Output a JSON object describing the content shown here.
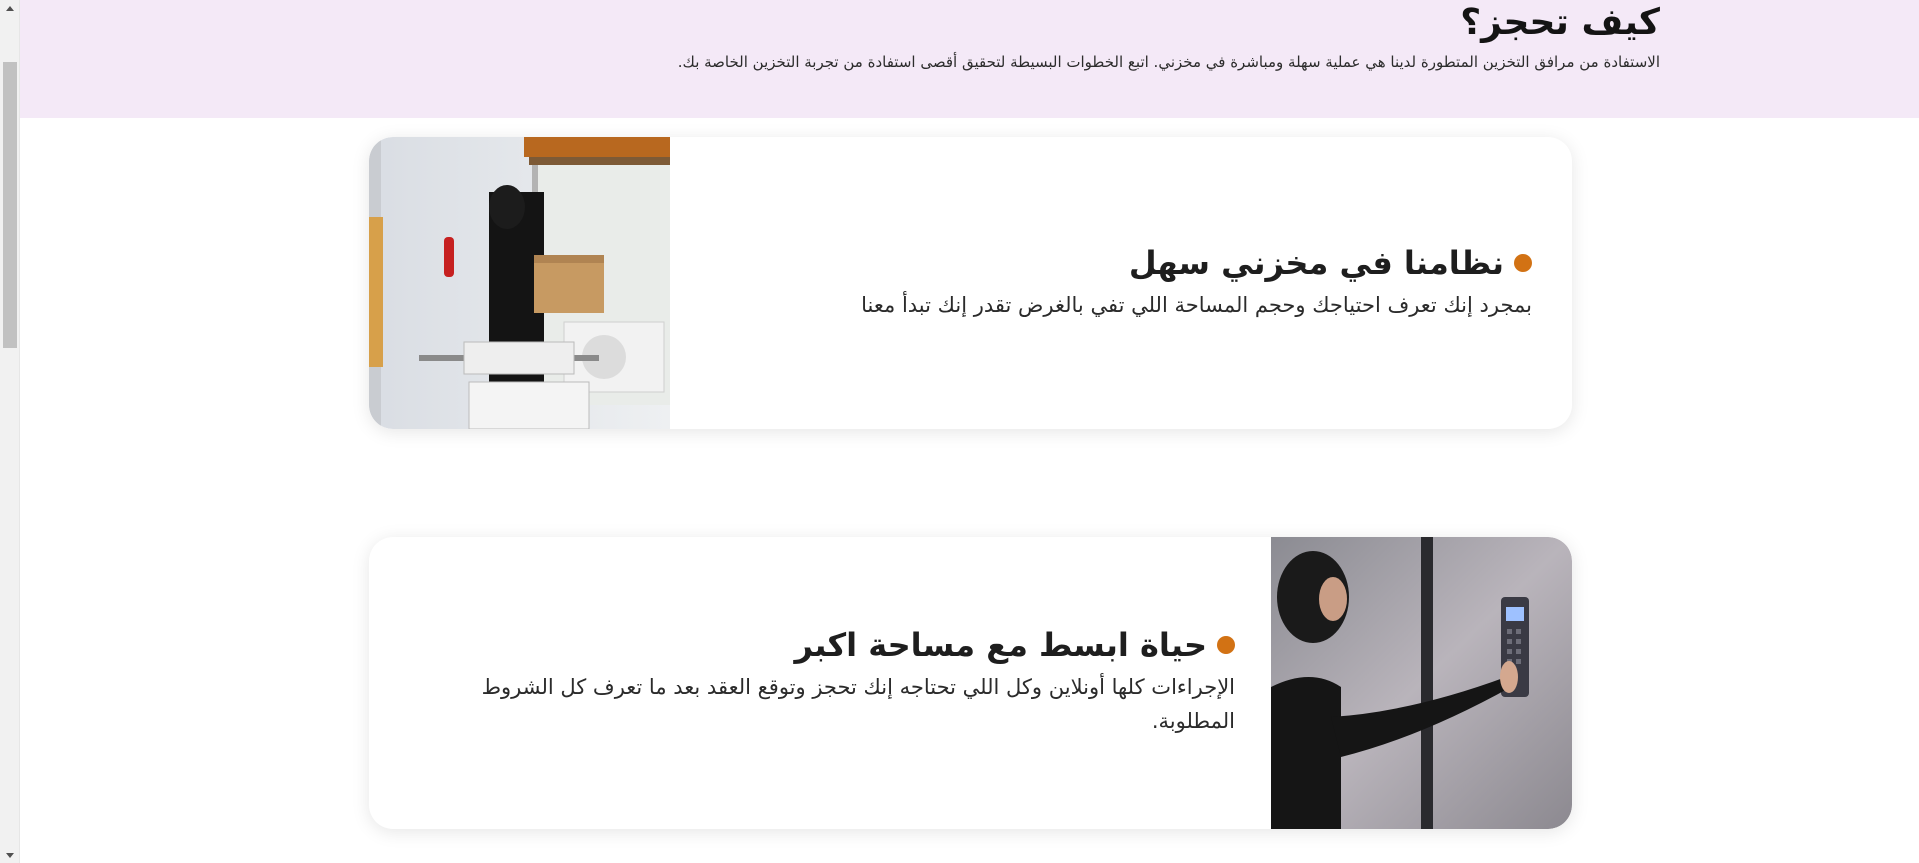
{
  "header": {
    "title": "كيف تحجز؟",
    "subtitle": "الاستفادة من مرافق التخزين المتطورة لدينا هي عملية سهلة ومباشرة في مخزني. اتبع الخطوات البسيطة لتحقيق أقصى استفادة من تجربة التخزين الخاصة بك."
  },
  "cards": [
    {
      "title": "نظامنا في مخزني سهل",
      "description": "بمجرد إنك تعرف احتياجك وحجم المساحة اللي تفي بالغرض تقدر إنك تبدأ معنا",
      "image": "woman-carrying-box-storage-photo"
    },
    {
      "title": "حياة ابسط مع مساحة اكبر",
      "description": "الإجراءات كلها أونلاين وكل اللي تحتاجه إنك تحجز وتوقع العقد بعد ما تعرف كل الشروط المطلوبة.",
      "image": "woman-using-keypad-photo"
    }
  ],
  "colors": {
    "header_background": "#f4e9f7",
    "accent_bullet": "#d27214",
    "card_background": "#ffffff"
  }
}
